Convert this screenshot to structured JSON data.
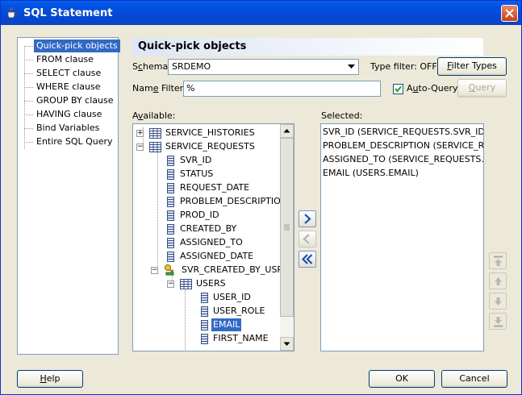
{
  "window": {
    "title": "SQL Statement"
  },
  "nav": {
    "items": [
      {
        "label": "Quick-pick objects",
        "selected": true
      },
      {
        "label": "FROM clause"
      },
      {
        "label": "SELECT clause"
      },
      {
        "label": "WHERE clause"
      },
      {
        "label": "GROUP BY clause"
      },
      {
        "label": "HAVING clause"
      },
      {
        "label": "Bind Variables"
      },
      {
        "label": "Entire SQL Query"
      }
    ]
  },
  "section": {
    "title": "Quick-pick objects"
  },
  "schema": {
    "label_pre": "S",
    "label_ul": "c",
    "label_post": "hema:",
    "value": "SRDEMO"
  },
  "type_filter": {
    "label": "Type filter: OFF",
    "button_ul": "F",
    "button_post": "ilter Types"
  },
  "name_filter": {
    "label_pre": "Nam",
    "label_ul": "e",
    "label_post": " Filter:",
    "value": "%"
  },
  "auto_query": {
    "label_pre": "A",
    "label_ul": "u",
    "label_post": "to-Query",
    "checked": true
  },
  "query_button": {
    "label_ul": "Q",
    "label_post": "uery"
  },
  "available": {
    "label_pre": "A",
    "label_ul": "v",
    "label_post": "ailable:",
    "tree": [
      {
        "label": "SERVICE_HISTORIES",
        "type": "table",
        "level": 0,
        "expander": "+"
      },
      {
        "label": "SERVICE_REQUESTS",
        "type": "table",
        "level": 0,
        "expander": "-"
      },
      {
        "label": "SVR_ID",
        "type": "column",
        "level": 1
      },
      {
        "label": "STATUS",
        "type": "column",
        "level": 1
      },
      {
        "label": "REQUEST_DATE",
        "type": "column",
        "level": 1
      },
      {
        "label": "PROBLEM_DESCRIPTION",
        "type": "column",
        "level": 1
      },
      {
        "label": "PROD_ID",
        "type": "column",
        "level": 1
      },
      {
        "label": "CREATED_BY",
        "type": "column",
        "level": 1
      },
      {
        "label": "ASSIGNED_TO",
        "type": "column",
        "level": 1
      },
      {
        "label": "ASSIGNED_DATE",
        "type": "column",
        "level": 1
      },
      {
        "label": "SVR_CREATED_BY_USR_I",
        "type": "fk",
        "level": 1,
        "expander": "-"
      },
      {
        "label": "USERS",
        "type": "table",
        "level": 2,
        "expander": "-"
      },
      {
        "label": "USER_ID",
        "type": "column",
        "level": 3
      },
      {
        "label": "USER_ROLE",
        "type": "column",
        "level": 3
      },
      {
        "label": "EMAIL",
        "type": "column",
        "level": 3,
        "selected": true
      },
      {
        "label": "FIRST_NAME",
        "type": "column",
        "level": 3
      }
    ]
  },
  "selected": {
    "label": "Selected:",
    "items": [
      "SVR_ID (SERVICE_REQUESTS.SVR_ID)",
      "PROBLEM_DESCRIPTION (SERVICE_REQU",
      "ASSIGNED_TO (SERVICE_REQUESTS.ASS",
      "EMAIL (USERS.EMAIL)"
    ]
  },
  "footer": {
    "help_ul": "H",
    "help_post": "elp",
    "ok": "OK",
    "cancel": "Cancel"
  },
  "colors": {
    "selection": "#316ac5",
    "titlebar": "#0254e3",
    "dialog": "#ece9d8"
  }
}
